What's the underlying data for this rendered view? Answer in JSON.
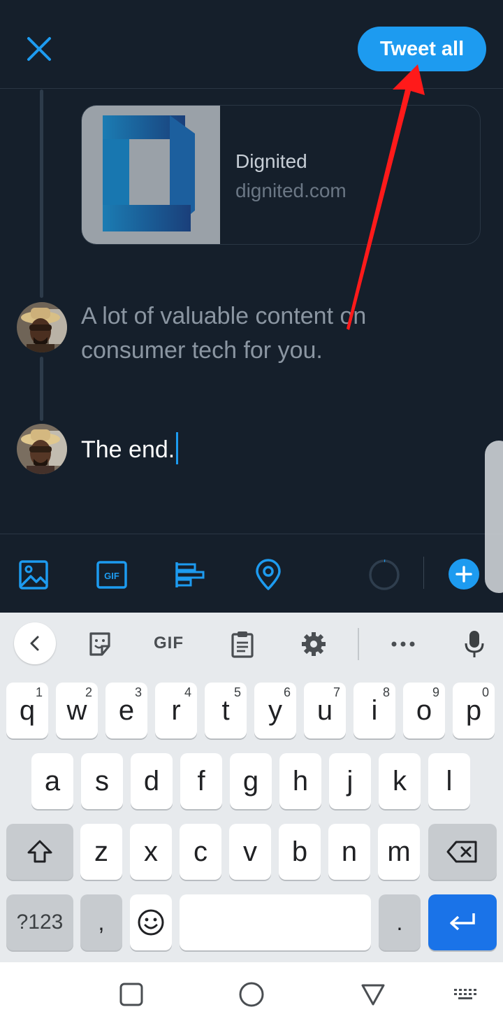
{
  "header": {
    "tweet_all_label": "Tweet all"
  },
  "link_card": {
    "title": "Dignited",
    "domain": "dignited.com"
  },
  "thread": {
    "tweet2_text": "A lot of valuable content on consumer tech for you.",
    "tweet3_text": "The end."
  },
  "toolbar": {
    "icons": [
      "image-icon",
      "gif-icon",
      "poll-icon",
      "location-icon",
      "character-counter-ring",
      "add-tweet-icon"
    ]
  },
  "keyboard": {
    "toolbar_gif_label": "GIF",
    "rows": [
      [
        {
          "k": "q",
          "h": "1"
        },
        {
          "k": "w",
          "h": "2"
        },
        {
          "k": "e",
          "h": "3"
        },
        {
          "k": "r",
          "h": "4"
        },
        {
          "k": "t",
          "h": "5"
        },
        {
          "k": "y",
          "h": "6"
        },
        {
          "k": "u",
          "h": "7"
        },
        {
          "k": "i",
          "h": "8"
        },
        {
          "k": "o",
          "h": "9"
        },
        {
          "k": "p",
          "h": "0"
        }
      ],
      [
        {
          "k": "a"
        },
        {
          "k": "s"
        },
        {
          "k": "d"
        },
        {
          "k": "f"
        },
        {
          "k": "g"
        },
        {
          "k": "h"
        },
        {
          "k": "j"
        },
        {
          "k": "k"
        },
        {
          "k": "l"
        }
      ],
      [
        {
          "k": "z"
        },
        {
          "k": "x"
        },
        {
          "k": "c"
        },
        {
          "k": "v"
        },
        {
          "k": "b"
        },
        {
          "k": "n"
        },
        {
          "k": "m"
        }
      ]
    ],
    "symbols_label": "?123",
    "comma_label": ",",
    "period_label": "."
  },
  "colors": {
    "accent": "#1d9bf0",
    "background": "#151f2b",
    "annotation_arrow": "#ff1a1a"
  }
}
